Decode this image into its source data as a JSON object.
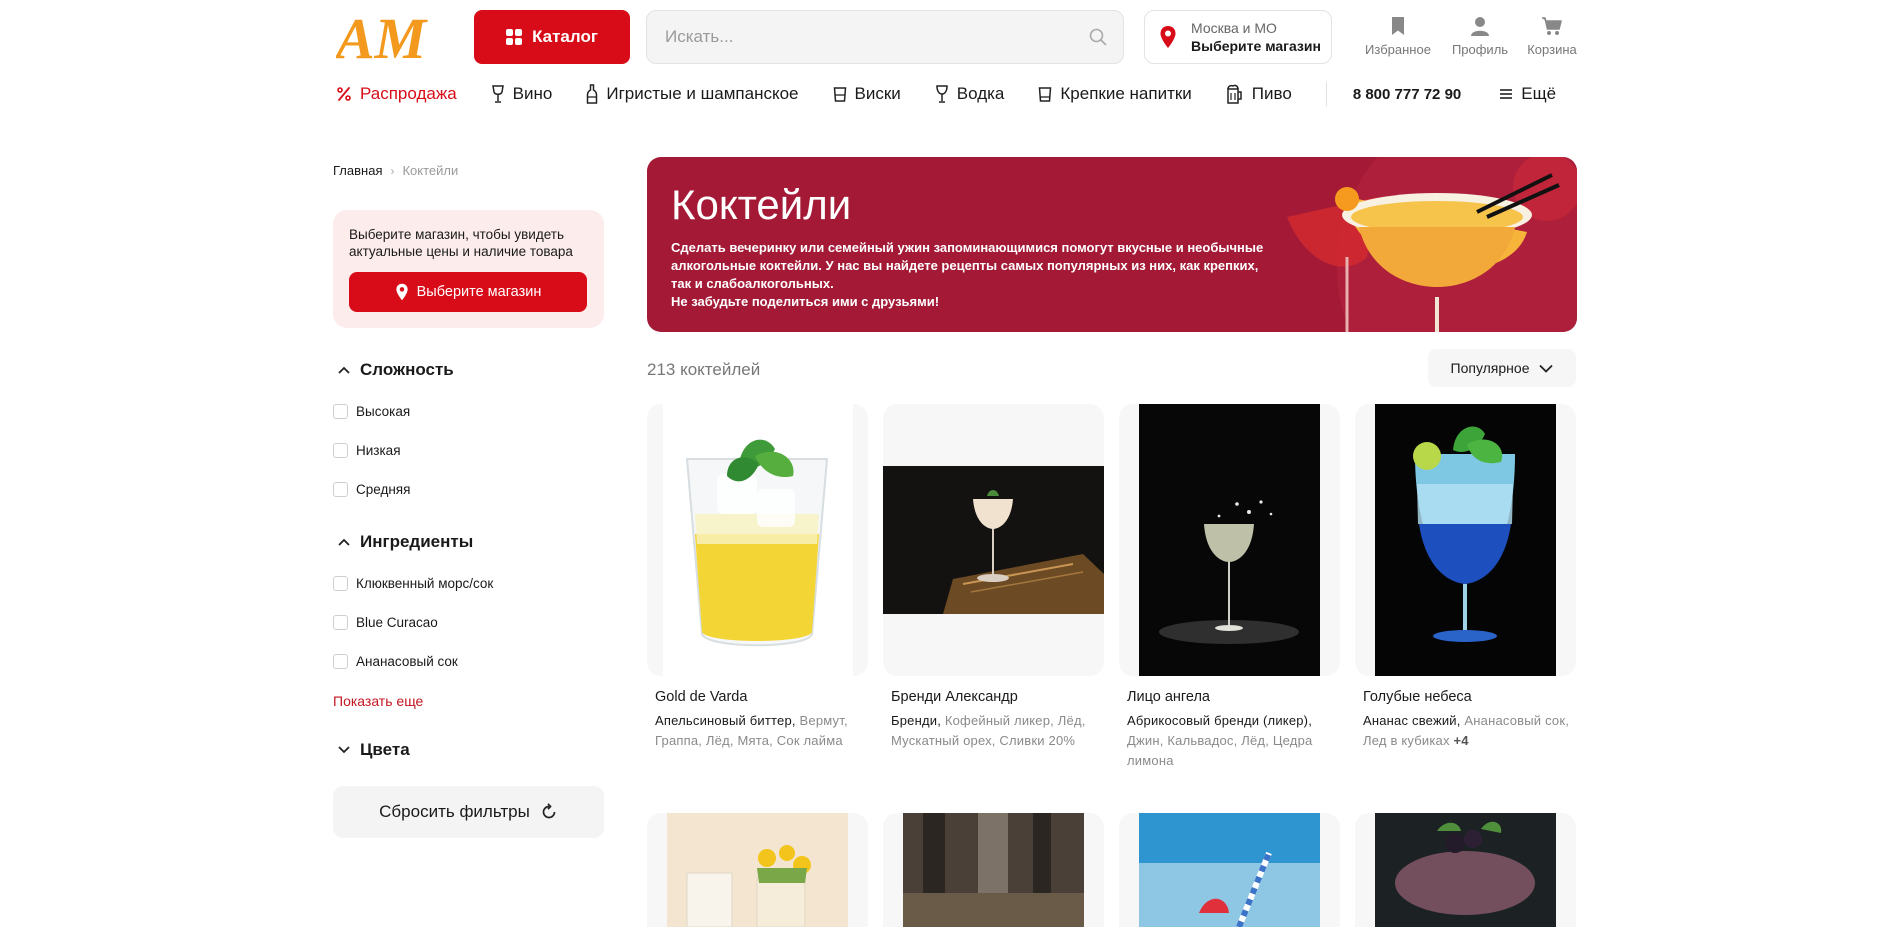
{
  "header": {
    "logo_text": "AM",
    "catalog_label": "Каталог",
    "search_placeholder": "Искать...",
    "store_region": "Москва и МО",
    "store_choose": "Выберите магазин",
    "favorites_label": "Избранное",
    "profile_label": "Профиль",
    "cart_label": "Корзина"
  },
  "nav": {
    "items": [
      {
        "label": "Распродажа",
        "icon": "percent-icon"
      },
      {
        "label": "Вино",
        "icon": "wine-glass-icon"
      },
      {
        "label": "Игристые и шампанское",
        "icon": "bottle-icon"
      },
      {
        "label": "Виски",
        "icon": "whisky-glass-icon"
      },
      {
        "label": "Водка",
        "icon": "shot-glass-icon"
      },
      {
        "label": "Крепкие напитки",
        "icon": "tumbler-icon"
      },
      {
        "label": "Пиво",
        "icon": "beer-mug-icon"
      }
    ],
    "phone": "8 800 777 72 90",
    "more_label": "Ещё"
  },
  "breadcrumb": {
    "home": "Главная",
    "current": "Коктейли"
  },
  "sidebar": {
    "store_message": "Выберите магазин, чтобы увидеть актуальные цены и наличие товара",
    "store_button": "Выберите магазин",
    "filters": [
      {
        "title": "Сложность",
        "expanded": true,
        "options": [
          "Высокая",
          "Низкая",
          "Средняя"
        ]
      },
      {
        "title": "Ингредиенты",
        "expanded": true,
        "options": [
          "Клюквенный морс/сок",
          "Blue Curacao",
          "Ананасовый сок"
        ]
      },
      {
        "title": "Цвета",
        "expanded": false,
        "options": []
      }
    ],
    "show_more": "Показать еще",
    "reset_label": "Сбросить фильтры"
  },
  "banner": {
    "title": "Коктейли",
    "line1": "Сделать вечеринку или семейный ужин запоминающимися помогут вкусные и необычные алкогольные коктейли. У нас вы найдете рецепты самых популярных из них, как крепких, так и слабоалкогольных.",
    "line2": "Не забудьте поделиться ими с друзьями!",
    "bg_color": "#a41a36"
  },
  "listing": {
    "count": "213 коктейлей",
    "sort_label": "Популярное"
  },
  "cards": [
    {
      "name": "Gold de Varda",
      "main": "Апельсиновый биттер,",
      "rest": "Вермут, Граппа, Лёд, Мята, Сок лайма",
      "extra": ""
    },
    {
      "name": "Бренди Александр",
      "main": "Бренди,",
      "rest": "Кофейный ликер, Лёд, Мускатный орех, Сливки 20%",
      "extra": ""
    },
    {
      "name": "Лицо ангела",
      "main": "Абрикосовый бренди (ликер),",
      "rest": "Джин, Кальвадос, Лёд, Цедра лимона",
      "extra": ""
    },
    {
      "name": "Голубые небеса",
      "main": "Ананас свежий,",
      "rest": "Ананасовый сок, Лед в кубиках",
      "extra": "+4"
    }
  ],
  "colors": {
    "brand_red": "#d80c18",
    "logo_orange": "#f39a1e"
  }
}
